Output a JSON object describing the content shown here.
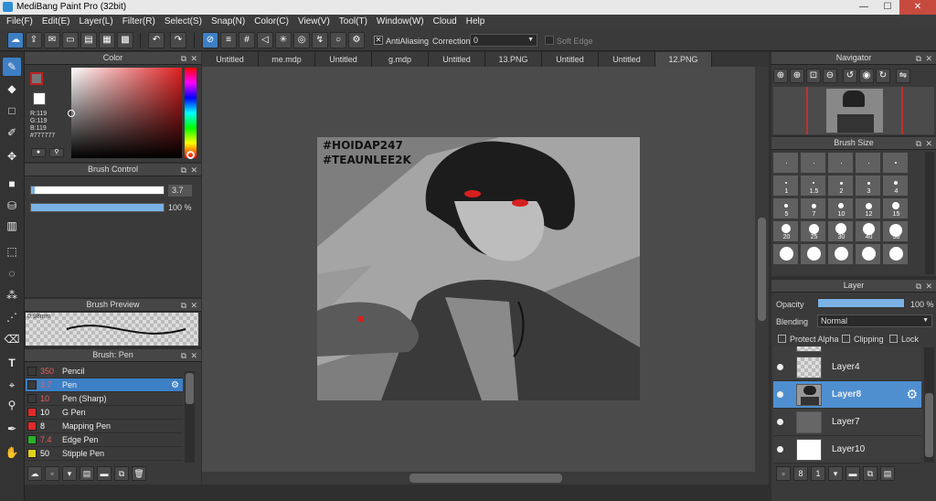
{
  "window": {
    "title": "MediBang Paint Pro (32bit)",
    "minimize": "—",
    "maximize": "☐",
    "close": "✕"
  },
  "menu": [
    "File(F)",
    "Edit(E)",
    "Layer(L)",
    "Filter(R)",
    "Select(S)",
    "Snap(N)",
    "Color(C)",
    "View(V)",
    "Tool(T)",
    "Window(W)",
    "Cloud",
    "Help"
  ],
  "toolbar": {
    "antialiasing_label": "AntiAliasing",
    "antialiasing_checked": "✕",
    "correction_label": "Correction",
    "correction_value": "0",
    "soft_edge_label": "Soft Edge"
  },
  "color_panel": {
    "title": "Color",
    "r": "R:119",
    "g": "G:119",
    "b": "B:119",
    "hex": "#777777"
  },
  "brush_control": {
    "title": "Brush Control",
    "size_value": "3.7",
    "size_fraction": 0.03,
    "opacity_value": "100 %",
    "opacity_fraction": 1.0
  },
  "brush_preview": {
    "title": "Brush Preview",
    "size_label": "0.98mm"
  },
  "brush_list": {
    "title": "Brush: Pen",
    "items": [
      {
        "value": "350",
        "name": "Pencil",
        "color": "#3a3a3a",
        "value_color": "#e06060"
      },
      {
        "value": "3.7",
        "name": "Pen",
        "color": "#3a3a3a",
        "value_color": "#e06060",
        "selected": true
      },
      {
        "value": "10",
        "name": "Pen (Sharp)",
        "color": "#3a3a3a",
        "value_color": "#e06060"
      },
      {
        "value": "10",
        "name": "G Pen",
        "color": "#e02a2a",
        "value_color": "#ffffff"
      },
      {
        "value": "8",
        "name": "Mapping Pen",
        "color": "#e02a2a",
        "value_color": "#ffffff"
      },
      {
        "value": "7.4",
        "name": "Edge Pen",
        "color": "#2ab02a",
        "value_color": "#e06060"
      },
      {
        "value": "50",
        "name": "Stipple Pen",
        "color": "#e0d020",
        "value_color": "#ffffff"
      }
    ]
  },
  "tabs": [
    {
      "label": "Untitled"
    },
    {
      "label": "me.mdp"
    },
    {
      "label": "Untitled"
    },
    {
      "label": "g.mdp"
    },
    {
      "label": "Untitled"
    },
    {
      "label": "13.PNG"
    },
    {
      "label": "Untitled"
    },
    {
      "label": "Untitled"
    },
    {
      "label": "12.PNG",
      "active": true
    }
  ],
  "artwork": {
    "line1": "#HOIDAP247",
    "line2": "#TEAUNLEE2K"
  },
  "navigator": {
    "title": "Navigator"
  },
  "brush_size": {
    "title": "Brush Size",
    "sizes": [
      "",
      "",
      "",
      "",
      "",
      "1",
      "1.5",
      "2",
      "3",
      "4",
      "5",
      "7",
      "10",
      "12",
      "15",
      "20",
      "25",
      "30",
      "40",
      "50",
      "",
      "",
      "",
      "",
      ""
    ]
  },
  "layer_panel": {
    "title": "Layer",
    "opacity_label": "Opacity",
    "opacity_value": "100 %",
    "opacity_fraction": 1.0,
    "blending_label": "Blending",
    "blending_value": "Normal",
    "protect_alpha": "Protect Alpha",
    "clipping": "Clipping",
    "lock": "Lock",
    "layers": [
      {
        "name": "Layer4"
      },
      {
        "name": "Layer8",
        "selected": true
      },
      {
        "name": "Layer7"
      },
      {
        "name": "Layer10"
      }
    ]
  },
  "colors": {
    "accent": "#3d7fc4",
    "panel": "#3a3a3a",
    "canvas_bg": "#4b4b4b"
  }
}
